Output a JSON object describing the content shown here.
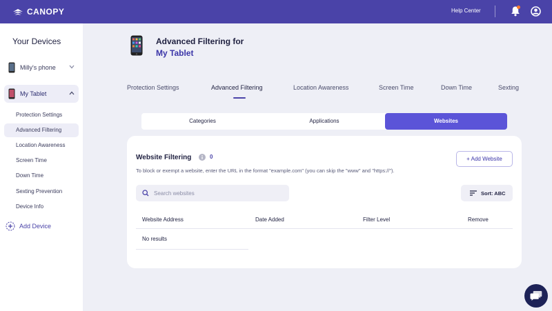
{
  "colors": {
    "brand": "#4a43a8",
    "accent": "#5b54d8",
    "notification": "#ff7a2a",
    "chat_bubble": "#1d2257"
  },
  "topbar": {
    "logo_text": "CANOPY",
    "help_center": "Help Center",
    "icons": [
      "canopy-logo-icon",
      "bell-icon",
      "user-icon"
    ]
  },
  "sidebar": {
    "title": "Your Devices",
    "devices": [
      {
        "label": "Milly's phone",
        "expanded": false
      },
      {
        "label": "My Tablet",
        "expanded": true
      }
    ],
    "sub_items": [
      "Protection Settings",
      "Advanced Filtering",
      "Location Awareness",
      "Screen Time",
      "Down Time",
      "Sexting Prevention",
      "Device Info"
    ],
    "active_sub_item": "Advanced Filtering",
    "add_device": "Add Device"
  },
  "page": {
    "title_line1": "Advanced Filtering for",
    "title_line2": "My Tablet"
  },
  "tabs": [
    "Protection Settings",
    "Advanced Filtering",
    "Location Awareness",
    "Screen Time",
    "Down Time",
    "Sexting"
  ],
  "active_tab": "Advanced Filtering",
  "segments": [
    "Categories",
    "Applications",
    "Websites"
  ],
  "active_segment": "Websites",
  "card": {
    "title": "Website Filtering",
    "count_badge": "0",
    "description": "To block or exempt a website, enter the URL in the format \"example.com\" (you can skip the \"www\" and \"https://\").",
    "add_button": "+ Add Website",
    "search_placeholder": "Search websites",
    "sort_label": "Sort: ABC",
    "columns": [
      "Website Address",
      "Date Added",
      "Filter Level",
      "Remove"
    ],
    "empty_text": "No results"
  }
}
